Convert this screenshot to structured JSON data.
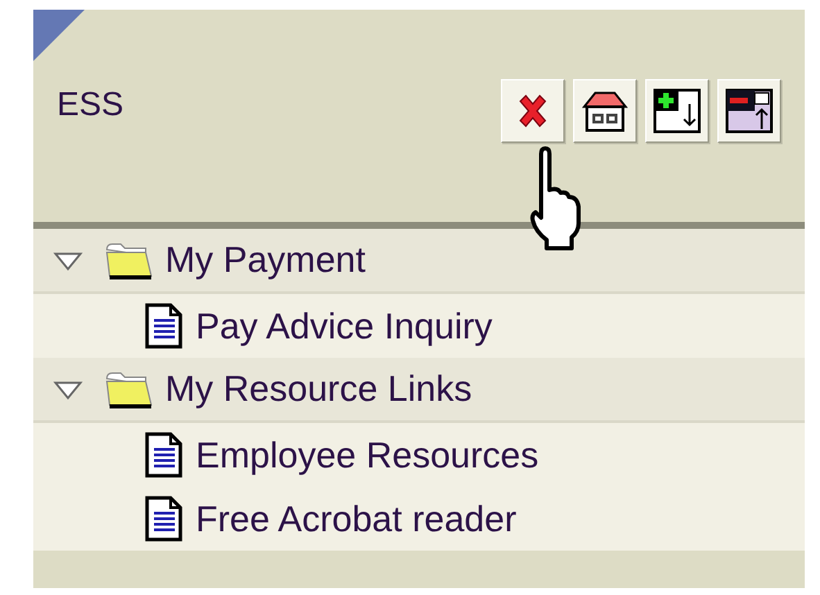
{
  "header": {
    "title": "ESS",
    "buttons": [
      {
        "kind": "close"
      },
      {
        "kind": "home"
      },
      {
        "kind": "add-down"
      },
      {
        "kind": "remove-up"
      }
    ]
  },
  "tree": [
    {
      "label": "My Payment",
      "expanded": true,
      "children": [
        {
          "label": "Pay Advice Inquiry"
        }
      ]
    },
    {
      "label": "My Resource Links",
      "expanded": true,
      "children": [
        {
          "label": "Employee Resources"
        },
        {
          "label": "Free Acrobat reader"
        }
      ]
    }
  ]
}
